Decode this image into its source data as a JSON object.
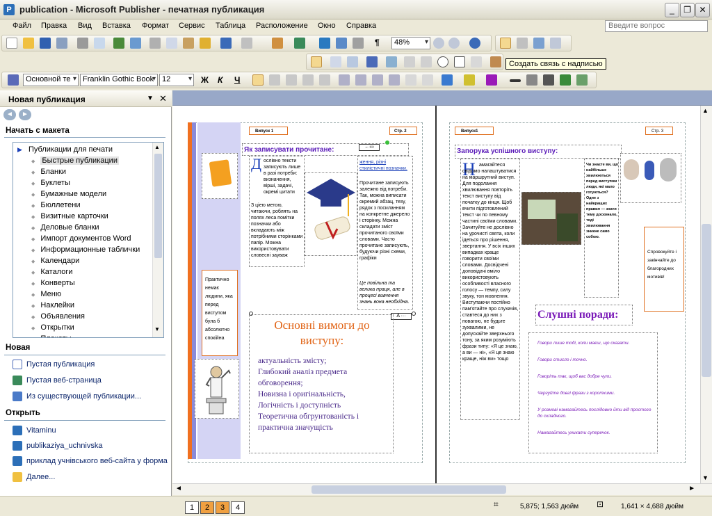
{
  "window": {
    "title": "publication - Microsoft Publisher - печатная публикация",
    "app_icon": "P",
    "buttons": [
      "_",
      "❐",
      "✕"
    ]
  },
  "menu": {
    "items": [
      "Файл",
      "Правка",
      "Вид",
      "Вставка",
      "Формат",
      "Сервис",
      "Таблица",
      "Расположение",
      "Окно",
      "Справка"
    ],
    "help_placeholder": "Введите вопрос"
  },
  "toolbar": {
    "zoom": "48%",
    "style": "Основной те",
    "font": "Franklin Gothic Book",
    "size": "12",
    "bold": "Ж",
    "italic": "К",
    "underline": "Ч",
    "tooltip": "Создать связь с надписью"
  },
  "taskpane": {
    "title": "Новая публикация",
    "section_start": "Начать с макета",
    "tree": {
      "root": "Публикации для печати",
      "items": [
        "Быстрые публикации",
        "Бланки",
        "Буклеты",
        "Бумажные модели",
        "Бюллетени",
        "Визитные карточки",
        "Деловые бланки",
        "Импорт документов Word",
        "Информационные таблички",
        "Календари",
        "Каталоги",
        "Конверты",
        "Меню",
        "Наклейки",
        "Объявления",
        "Открытки",
        "Плакаты"
      ]
    },
    "section_new": "Новая",
    "new_items": [
      "Пустая публикация",
      "Пустая веб-страница",
      "Из существующей публикации..."
    ],
    "section_open": "Открыть",
    "open_items": [
      "Vitaminu",
      "publikaziya_uchnivska",
      "приклад учнівського веб-сайта у форма",
      "Далее..."
    ]
  },
  "document": {
    "left_page": {
      "issue": "Випуск 1",
      "page": "Стр. 2",
      "heading": "Як записувати прочитане:",
      "col1_initial": "Д",
      "col1_text": "ослівно тексти записують лише в разі потреби: визначення, вірші, задачі, окремі цитати тощо.",
      "col1_text2": "З ціею метою, читаючи, роблять на полях леса помітки позначки або вкладають між потрібними сторінками папір. Можна використовувати словесні зауваж",
      "col2_text": "ження, різні стилістичні позначки.",
      "col2_text2": "Прочитане записують залежно від потреби. Так, можна виписати окремий абзац, тезу, рядок з посиланням на конкретне джерело і сторінку. Можна складати зміст прочитаного своїми словами. Часто прочитане записують, будуючи різні схеми, графіки",
      "col2_text3": "Це повільна та велика праця, але в процесі вивчення знань вона необхідна.",
      "side_text": "Практично немає людини, яка перед виступом була б абсолютно спокійна",
      "req_title": "Основні вимоги до виступу:",
      "req_items": [
        "актуальність змісту;",
        "Глибокий аналіз предмета обговорення;",
        "Новизна і оригінальність,",
        "Логічність і доступність",
        "Теоретична обгрунтованість і практична значущість"
      ]
    },
    "right_page": {
      "issue": "Випуск1",
      "page": "Стр. 3",
      "heading": "Запорука успішного виступу:",
      "body_initial": "Н",
      "body_text": "амагайтеся свідомо налаштуватися на маршрутний виступ. Для подолання хвилювання повторіть текст виступу від початку до кінця. Щоб вчити підготовлений текст чи по певному частині своїми словами. Зачитуйте не дослівно на урочисті свята, коли ідеться про рішення, звертання. У всіх інших випадках краще говорити своїми словами. Досвідчені доповідачі вміло використовують особливості власного голосу — темпу, силу звуку, тон мовлення. Виступаючи постійно пам'ятайте про слухачів, ставтеся до них з повагою, не будьте зухвалими, не допускайте зверхнього тону, за яким розуміють фрази типу: «Я це знаю, а ви — ні», «Я це знаю краще, ніж ви» тощо",
      "small_text": "Чи знаєте ви, що найбільше хвилюються перед виступом люди, які мало готуються? Одне з найкращих правил — знати тему досконало, тоді хвилювання зникне само собою.",
      "orange_text": "Спровокуйте і закінчайте до благородних мотивів!",
      "tips_title": "Слушні поради:",
      "tips": [
        "Говори лише тоді, коли маєш, що сказати.",
        "Говори стисло і точно.",
        "Говоріть так, щоб вас добре чули.",
        "Чергуйте довгі фрази з короткими.",
        "У розмові намагайтесь послідовно йти від простого до складного.",
        "Намагайтесь уникати суперечок."
      ]
    }
  },
  "status": {
    "pages": [
      "1",
      "2",
      "3",
      "4"
    ],
    "active_pages": [
      "2",
      "3"
    ],
    "position": "5,875; 1,563 дюйм",
    "size": "1,641 × 4,688 дюйм"
  }
}
